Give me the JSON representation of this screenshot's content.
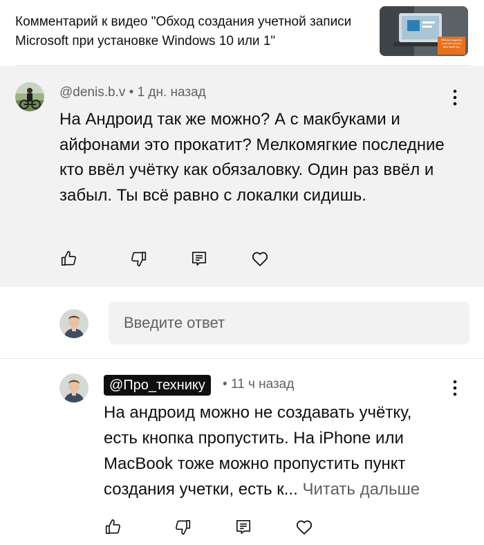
{
  "header": {
    "title": "Комментарий к видео \"Обход создания учетной записи Microsoft при установке Windows 10 или 1\"",
    "thumb_caption": "Обход создания учетной записи Microsoft при"
  },
  "parent_comment": {
    "author": "@denis.b.v",
    "separator": "•",
    "time": "1 дн. назад",
    "text": "На Андроид так же можно? А с макбуками и айфонами это прокатит? Мелкомягкие последние кто ввёл учётку как обязаловку. Один раз ввёл и забыл. Ты всё равно с локалки сидишь.",
    "actions": [
      "like-icon",
      "dislike-icon",
      "reply-icon",
      "heart-icon"
    ]
  },
  "reply_box": {
    "placeholder": "Введите ответ"
  },
  "reply_comment": {
    "author": "@Про_технику",
    "separator": "•",
    "time": "11 ч назад",
    "text": "На андроид можно не создавать учётку, есть кнопка пропустить. На iPhone или MacBook тоже можно пропустить пункт создания учетки, есть к...",
    "read_more": "Читать дальше",
    "actions": [
      "like-icon",
      "dislike-icon",
      "reply-icon",
      "heart-icon"
    ]
  },
  "colors": {
    "parent_background": "#f2f2f2",
    "secondary_text": "#606060",
    "primary_text": "#0f0f0f",
    "creator_badge": "#0f0f0f"
  }
}
